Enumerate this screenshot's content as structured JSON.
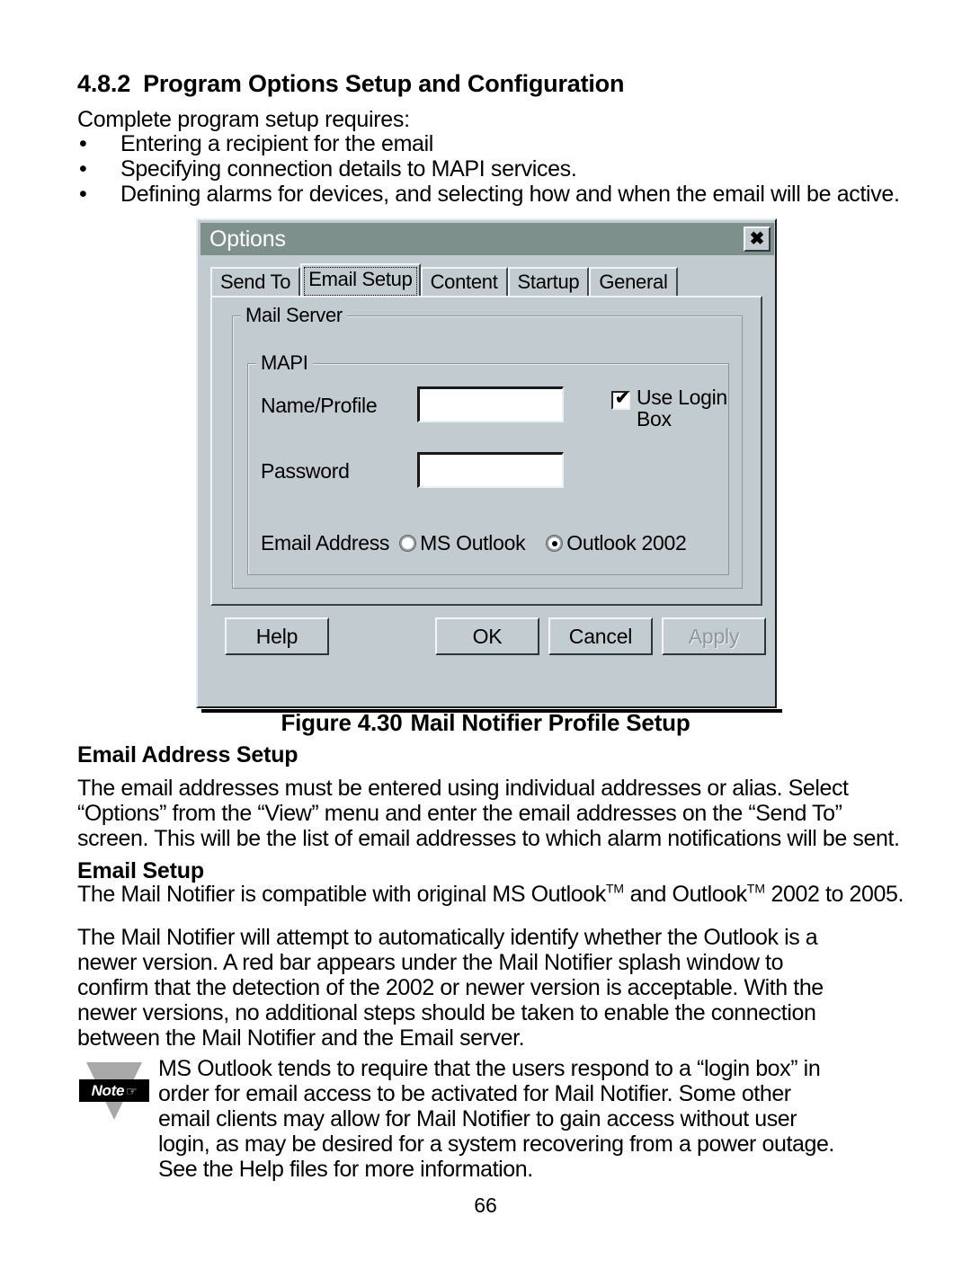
{
  "document": {
    "section_number": "4.8.2",
    "section_title": "Program Options Setup and Configuration",
    "lead_in": "Complete program setup requires:",
    "bullet_glyph": "•",
    "bullets": [
      "Entering a recipient for the email",
      "Specifying connection details to MAPI services.",
      "Defining alarms for devices, and selecting how and when the email will be active."
    ],
    "figure_caption_number": "Figure 4.30",
    "figure_caption_title": "Mail Notifier Profile Setup",
    "heading_email_address_setup": "Email Address Setup",
    "paragraph_email_address_setup": [
      "The email addresses must be entered using individual addresses or alias. Select",
      "“Options” from the “View” menu and enter the email addresses on the “Send To”",
      "screen. This will be the list of email addresses to which alarm notifications will be sent."
    ],
    "heading_email_setup": "Email Setup",
    "paragraph_compatible": {
      "part1": "The Mail Notifier is compatible with original MS Outlook",
      "tm1": "TM",
      "part2": " and Outlook",
      "tm2": "TM",
      "part3": " 2002 to 2005."
    },
    "paragraph_detect": [
      "The Mail Notifier will attempt to automatically identify whether the Outlook is a",
      "newer version.  A red bar appears under the Mail Notifier splash window to",
      "confirm that the detection of the 2002 or newer version is acceptable.  With the",
      "newer versions, no additional steps should be taken to enable the connection",
      "between the Mail Notifier and the Email server."
    ],
    "note": {
      "icon_label": "Note",
      "icon_hand": "☞",
      "lines": [
        "MS Outlook tends to require that the users respond to a “login box” in",
        "order for email access to be activated for Mail Notifier.  Some other",
        "email clients may allow for Mail Notifier to gain access without user",
        "login, as may be desired for a system recovering from a power outage.",
        "See the Help files for more information."
      ]
    },
    "page_number": "66"
  },
  "dialog": {
    "title": "Options",
    "close_label": "✖",
    "tabs": [
      {
        "label": "Send To",
        "active": false
      },
      {
        "label": "Email Setup",
        "active": true
      },
      {
        "label": "Content",
        "active": false
      },
      {
        "label": "Startup",
        "active": false
      },
      {
        "label": "General",
        "active": false
      }
    ],
    "groups": {
      "mail_server": "Mail Server",
      "mapi": "MAPI"
    },
    "fields": {
      "name_profile_label": "Name/Profile",
      "name_profile_value": "",
      "password_label": "Password",
      "password_value": ""
    },
    "checkbox": {
      "label": "Use Login Box",
      "checked": true,
      "tick_glyph": "✔"
    },
    "radio_group": {
      "label": "Email Address",
      "options": [
        {
          "label": "MS Outlook",
          "selected": false
        },
        {
          "label": "Outlook 2002",
          "selected": true
        }
      ]
    },
    "buttons": {
      "help": "Help",
      "ok": "OK",
      "cancel": "Cancel",
      "apply": "Apply",
      "apply_disabled": true
    },
    "colors": {
      "titlebar": "#7e908c",
      "face": "#c2cbd0",
      "title_text": "#ffffff",
      "disabled_text": "#8e989d"
    }
  }
}
